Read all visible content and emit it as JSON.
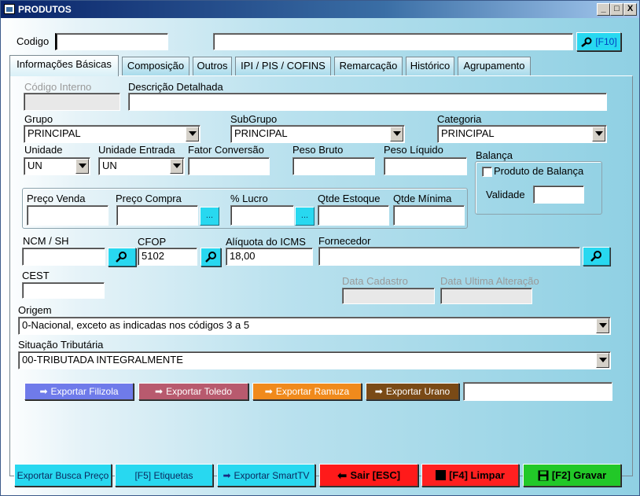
{
  "window": {
    "title": "PRODUTOS",
    "minimize": "_",
    "maximize": "□",
    "close": "X"
  },
  "top": {
    "codigo_label": "Codigo",
    "codigo_value": "",
    "descricao_value": "",
    "search_button": "[F10]"
  },
  "tabs": [
    {
      "label": "Informações Básicas",
      "active": true
    },
    {
      "label": "Composição"
    },
    {
      "label": "Outros"
    },
    {
      "label": "IPI / PIS / COFINS"
    },
    {
      "label": "Remarcação"
    },
    {
      "label": "Histórico"
    },
    {
      "label": "Agrupamento"
    }
  ],
  "form": {
    "codigo_interno_label": "Código Interno",
    "codigo_interno_value": "",
    "descricao_detalhada_label": "Descrição Detalhada",
    "descricao_detalhada_value": "",
    "grupo_label": "Grupo",
    "grupo_value": "PRINCIPAL",
    "subgrupo_label": "SubGrupo",
    "subgrupo_value": "PRINCIPAL",
    "categoria_label": "Categoria",
    "categoria_value": "PRINCIPAL",
    "unidade_label": "Unidade",
    "unidade_value": "UN",
    "unidade_entrada_label": "Unidade Entrada",
    "unidade_entrada_value": "UN",
    "fator_conversao_label": "Fator Conversão",
    "fator_conversao_value": "",
    "peso_bruto_label": "Peso Bruto",
    "peso_bruto_value": "",
    "peso_liquido_label": "Peso Líquido",
    "peso_liquido_value": "",
    "balanca_label": "Balança",
    "produto_balanca_label": "Produto de Balança",
    "validade_label": "Validade",
    "validade_value": "",
    "preco_venda_label": "Preço Venda",
    "preco_venda_value": "",
    "preco_compra_label": "Preço Compra",
    "preco_compra_value": "",
    "lucro_label": "% Lucro",
    "lucro_value": "",
    "qtde_estoque_label": "Qtde Estoque",
    "qtde_estoque_value": "",
    "qtde_minima_label": "Qtde Mínima",
    "qtde_minima_value": "",
    "dots_label": "...",
    "ncm_label": "NCM / SH",
    "ncm_value": "",
    "cfop_label": "CFOP",
    "cfop_value": "5102",
    "icms_label": "Alíquota do ICMS",
    "icms_value": "18,00",
    "fornecedor_label": "Fornecedor",
    "fornecedor_value": "",
    "cest_label": "CEST",
    "cest_value": "",
    "data_cadastro_label": "Data Cadastro",
    "data_cadastro_value": "",
    "data_alteracao_label": "Data Ultima Alteração",
    "data_alteracao_value": "",
    "origem_label": "Origem",
    "origem_value": "0-Nacional, exceto as indicadas nos códigos 3 a 5",
    "situacao_label": "Situação Tributária",
    "situacao_value": "00-TRIBUTADA INTEGRALMENTE"
  },
  "export": {
    "filizola": "Exportar Filizola",
    "toledo": "Exportar Toledo",
    "ramuza": "Exportar Ramuza",
    "urano": "Exportar Urano",
    "status_value": ""
  },
  "bottom": {
    "busca_preco": "Exportar Busca Preço",
    "etiquetas": "[F5] Etiquetas",
    "smarttv": "Exportar SmartTV",
    "sair": "Sair [ESC]",
    "limpar": "[F4] Limpar",
    "gravar": "[F2] Gravar"
  },
  "colors": {
    "filizola": "#6f7bea",
    "toledo": "#b85a6e",
    "ramuza": "#f08a1c",
    "urano": "#7a4a16",
    "sair": "#ff1a1a",
    "limpar": "#ff2020",
    "gravar": "#22c828",
    "cyan": "#28d8f0"
  }
}
